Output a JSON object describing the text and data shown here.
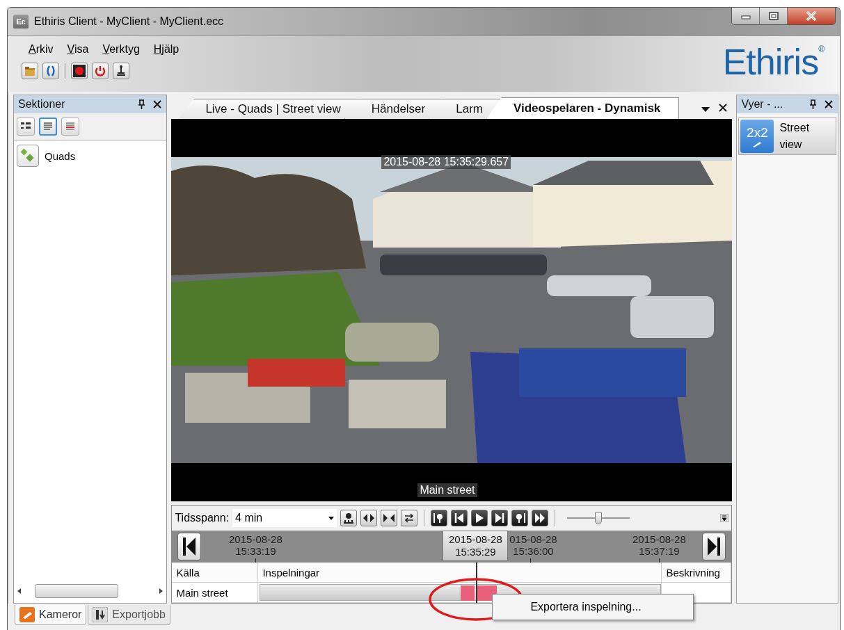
{
  "window": {
    "title": "Ethiris Client - MyClient - MyClient.ecc",
    "app_icon": "Ec"
  },
  "menu": [
    "Arkiv",
    "Visa",
    "Verktyg",
    "Hjälp"
  ],
  "logo": {
    "text": "Ethiris",
    "mark": "®"
  },
  "sections_pane": {
    "title": "Sektioner",
    "view_buttons": [
      {
        "kind": "tree",
        "selected": false
      },
      {
        "kind": "list",
        "selected": true
      },
      {
        "kind": "redlist",
        "selected": false
      }
    ],
    "items": [
      {
        "label": "Quads"
      }
    ]
  },
  "tabs": [
    {
      "label": "Live - Quads | Street view",
      "selected": false
    },
    {
      "label": "Händelser",
      "selected": false
    },
    {
      "label": "Larm",
      "selected": false
    },
    {
      "label": "Videospelaren - Dynamisk",
      "selected": true
    }
  ],
  "player": {
    "timestamp": "2015-08-28 15:35:29.657",
    "camera": "Main street",
    "timespan_label": "Tidsspann:",
    "timespan": "4 min",
    "speed": {
      "level": 0.5
    },
    "timeline": {
      "ticks": [
        {
          "date": "2015-08-28",
          "time": "15:33:19"
        },
        {
          "date": "015-08-28",
          "time": "15:36:00"
        },
        {
          "date": "2015-08-28",
          "time": "15:37:19"
        }
      ],
      "current": {
        "date": "2015-08-28",
        "time": "15:35:29"
      }
    },
    "columns": [
      "Källa",
      "Inspelningar",
      "Beskrivning"
    ],
    "rows": [
      {
        "source": "Main street"
      }
    ],
    "context_menu": [
      "Exportera inspelning..."
    ]
  },
  "views_pane": {
    "title": "Vyer - ...",
    "items": [
      {
        "badge": "2x2",
        "label": "Street view"
      }
    ]
  },
  "bottom_tabs": [
    {
      "label": "Kameror",
      "selected": true
    },
    {
      "label": "Exportjobb",
      "selected": false
    }
  ]
}
